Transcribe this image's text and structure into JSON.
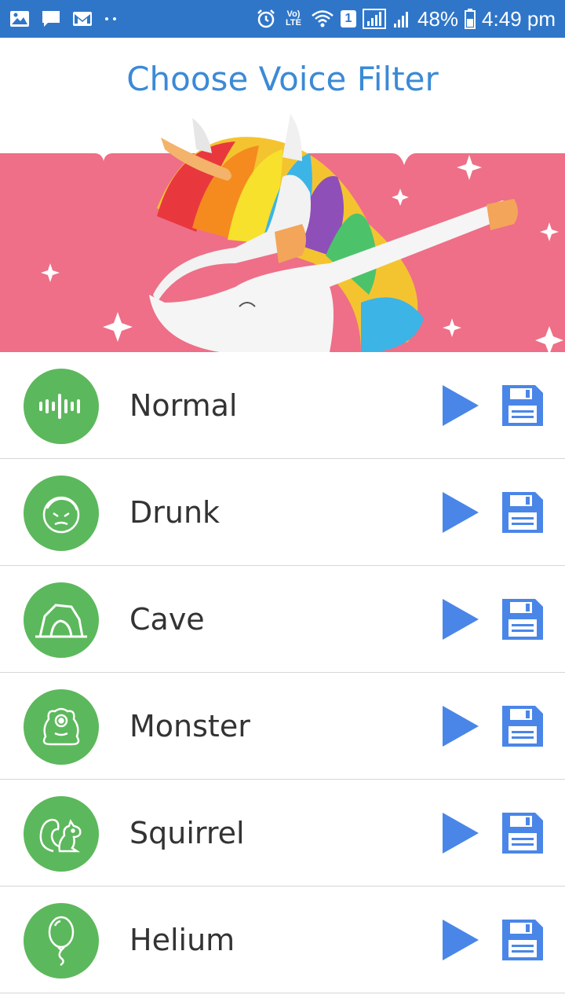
{
  "status_bar": {
    "battery": "48%",
    "time": "4:49 pm",
    "notification_badge": "1",
    "network_label": "Vo) LTE",
    "left_icons": [
      "image-icon",
      "message-icon",
      "gmail-icon",
      "more-dots-icon"
    ],
    "right_icons": [
      "alarm-icon",
      "volte-icon",
      "wifi-icon",
      "sim-badge-icon",
      "signal-icon",
      "signal-icon-2",
      "battery-icon"
    ]
  },
  "page": {
    "title": "Choose Voice Filter"
  },
  "colors": {
    "status_bar": "#2f76c9",
    "title": "#3b8ad6",
    "banner_pink": "#ee6f87",
    "avatar_green": "#5cb85c",
    "action_blue": "#4a86e8"
  },
  "filters": [
    {
      "label": "Normal",
      "icon": "soundwave-icon"
    },
    {
      "label": "Drunk",
      "icon": "drunk-face-icon"
    },
    {
      "label": "Cave",
      "icon": "cave-icon"
    },
    {
      "label": "Monster",
      "icon": "monster-icon"
    },
    {
      "label": "Squirrel",
      "icon": "squirrel-icon"
    },
    {
      "label": "Helium",
      "icon": "balloon-icon"
    }
  ]
}
